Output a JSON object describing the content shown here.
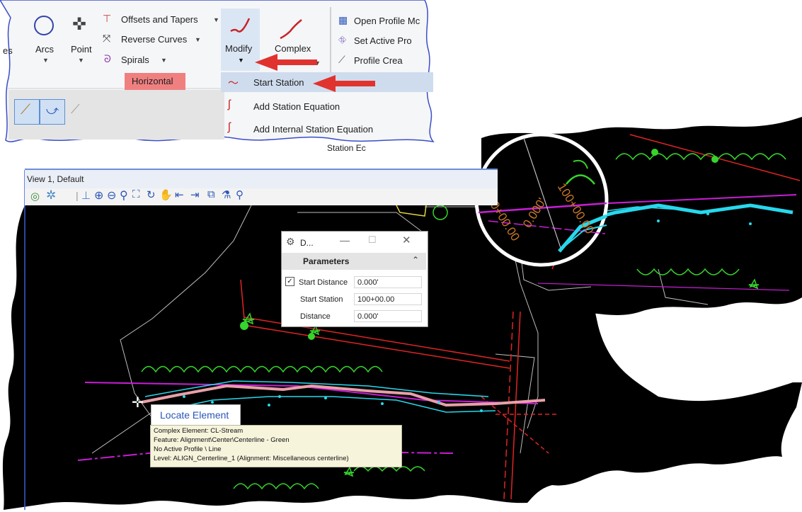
{
  "ribbon": {
    "left_cut_label": "es",
    "arcs_label": "Arcs",
    "point_label": "Point",
    "offsets_label": "Offsets and Tapers",
    "reverse_label": "Reverse Curves",
    "spirals_label": "Spirals",
    "group_label": "Horizontal",
    "modify_label": "Modify",
    "complex_label": "Complex",
    "open_profile_label": "Open Profile Mc",
    "set_active_label": "Set Active Pro",
    "profile_crea_label": "Profile Crea"
  },
  "modify_menu": {
    "items": [
      {
        "label": "Start Station"
      },
      {
        "label": "Add Station Equation"
      },
      {
        "label": "Add Internal Station Equation"
      },
      {
        "label": "Station Ec"
      }
    ]
  },
  "view": {
    "title": "View 1, Default"
  },
  "dialog": {
    "title": "D...",
    "section": "Parameters",
    "rows": [
      {
        "label": "Start Distance",
        "value": "0.000'",
        "checked": true
      },
      {
        "label": "Start Station",
        "value": "100+00.00"
      },
      {
        "label": "Distance",
        "value": "0.000'"
      }
    ]
  },
  "tooltip": {
    "heading": "Locate Element",
    "lines": [
      "Complex Element: CL-Stream",
      "Feature: Alignment\\Center\\Centerline - Green",
      "No Active Profile \\ Line",
      "Level: ALIGN_Centerline_1 (Alignment: Miscellaneous centerline)"
    ]
  },
  "zoom_annotations": {
    "station_text": "100+00.00",
    "distance_text": "0.000'"
  },
  "colors": {
    "accent_red": "#e0332f",
    "canvas": "#000000",
    "tree_green": "#36d42c",
    "alignment_magenta": "#c81ed6",
    "stream_cyan": "#27d8ec",
    "label_orange": "#c9782a",
    "group_highlight": "#f08080"
  }
}
